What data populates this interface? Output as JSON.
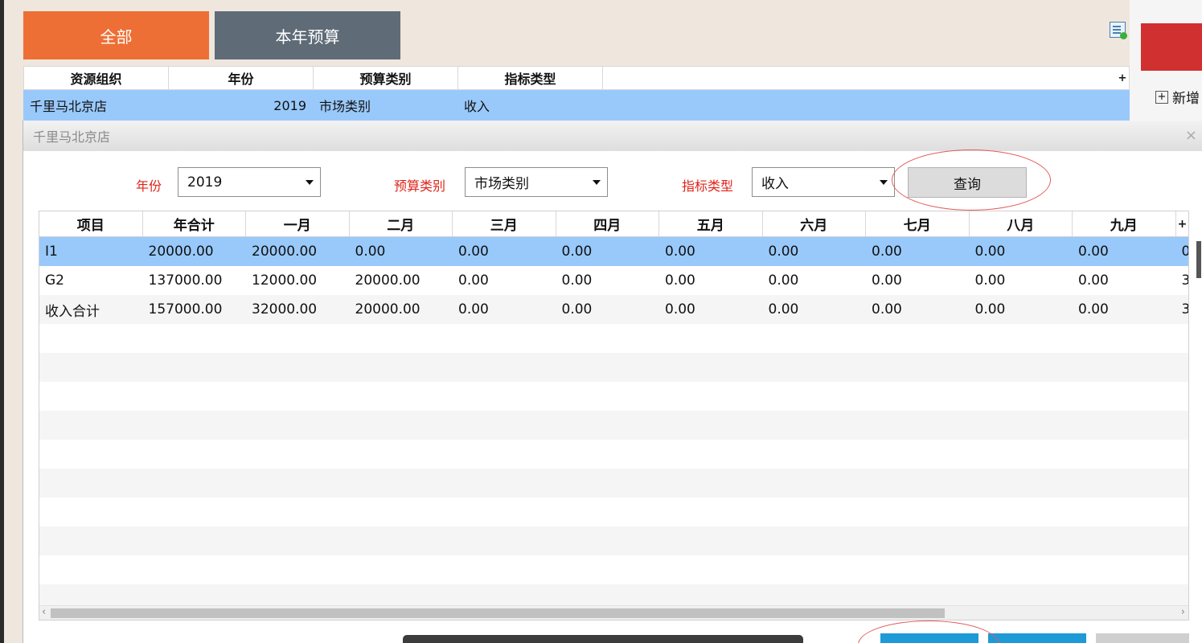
{
  "app": {
    "tabs": [
      {
        "label": "全部",
        "color": "#ee6f35"
      },
      {
        "label": "本年预算",
        "color": "#5f6b77"
      }
    ],
    "bg_table": {
      "columns": [
        "资源组织",
        "年份",
        "预算类别",
        "指标类型"
      ],
      "plus": "+",
      "row": {
        "org": "千里马北京店",
        "year": "2019",
        "category": "市场类别",
        "type": "收入"
      }
    },
    "right_panel": {
      "add_label": "新增"
    }
  },
  "dialog": {
    "title": "千里马北京店",
    "close": "×",
    "filters": {
      "year_label": "年份",
      "year_value": "2019",
      "category_label": "预算类别",
      "category_value": "市场类别",
      "type_label": "指标类型",
      "type_value": "收入",
      "query_label": "查询"
    },
    "grid": {
      "columns": [
        "项目",
        "年合计",
        "一月",
        "二月",
        "三月",
        "四月",
        "五月",
        "六月",
        "七月",
        "八月",
        "九月"
      ],
      "plus": "+",
      "rows": [
        [
          "I1",
          "20000.00",
          "20000.00",
          "0.00",
          "0.00",
          "0.00",
          "0.00",
          "0.00",
          "0.00",
          "0.00",
          "0.00",
          "0"
        ],
        [
          "G2",
          "137000.00",
          "12000.00",
          "20000.00",
          "0.00",
          "0.00",
          "0.00",
          "0.00",
          "0.00",
          "0.00",
          "0.00",
          "3"
        ],
        [
          "收入合计",
          "157000.00",
          "32000.00",
          "20000.00",
          "0.00",
          "0.00",
          "0.00",
          "0.00",
          "0.00",
          "0.00",
          "0.00",
          "3"
        ]
      ],
      "scroll_left": "‹",
      "scroll_right": "›"
    },
    "colors": {
      "selected_row": "#99c9fb",
      "label_red": "#e0241b",
      "bottom_blue": "#1e9ad6"
    }
  }
}
